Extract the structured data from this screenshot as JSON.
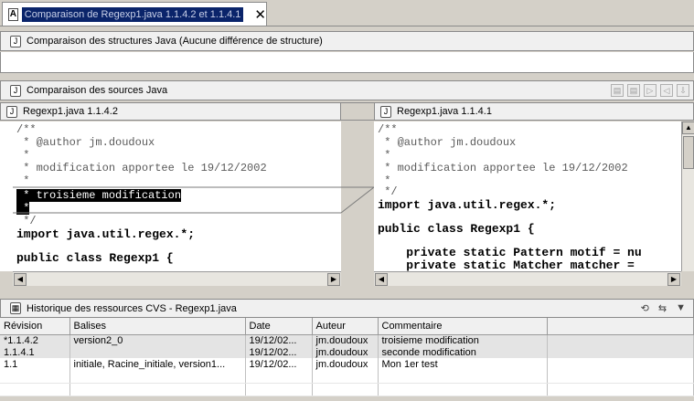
{
  "editor_tab": {
    "icon": "A",
    "title": "Comparaison de Regexp1.java 1.1.4.2 et 1.1.4.1",
    "close": "✕"
  },
  "structure_pane": {
    "title": "Comparaison des structures Java  (Aucune différence de structure)"
  },
  "source_pane": {
    "title": "Comparaison des sources Java"
  },
  "left_file": {
    "header": "Regexp1.java 1.1.4.2",
    "lines": [
      "/**",
      " * @author jm.doudoux",
      " *",
      " * modification apportee le 19/12/2002",
      " *",
      " * troisieme modification",
      " *",
      " */",
      "import java.util.regex.*;",
      "public class Regexp1 {"
    ]
  },
  "right_file": {
    "header": "Regexp1.java 1.1.4.1",
    "lines": [
      "/**",
      " * @author jm.doudoux",
      " *",
      " * modification apportee le 19/12/2002",
      " *",
      " */",
      "import java.util.regex.*;",
      "public class Regexp1 {",
      "    private static Pattern motif = nu",
      "    private static Matcher matcher = "
    ]
  },
  "history_pane": {
    "title": "Historique des ressources CVS - Regexp1.java",
    "columns": [
      "Révision",
      "Balises",
      "Date",
      "Auteur",
      "Commentaire"
    ],
    "rows": [
      {
        "revision": "*1.1.4.2",
        "tags": "version2_0",
        "date": "19/12/02...",
        "author": "jm.doudoux",
        "comment": "troisieme modification"
      },
      {
        "revision": "1.1.4.1",
        "tags": "",
        "date": "19/12/02...",
        "author": "jm.doudoux",
        "comment": "seconde modification"
      },
      {
        "revision": "1.1",
        "tags": "initiale, Racine_initiale, version1...",
        "date": "19/12/02...",
        "author": "jm.doudoux",
        "comment": "Mon 1er test"
      }
    ]
  },
  "colors": {
    "title_highlight": "#0a246a",
    "panel": "#d4d0c8",
    "header": "#f0f0f0",
    "diff_line": "#7a7a7a"
  }
}
